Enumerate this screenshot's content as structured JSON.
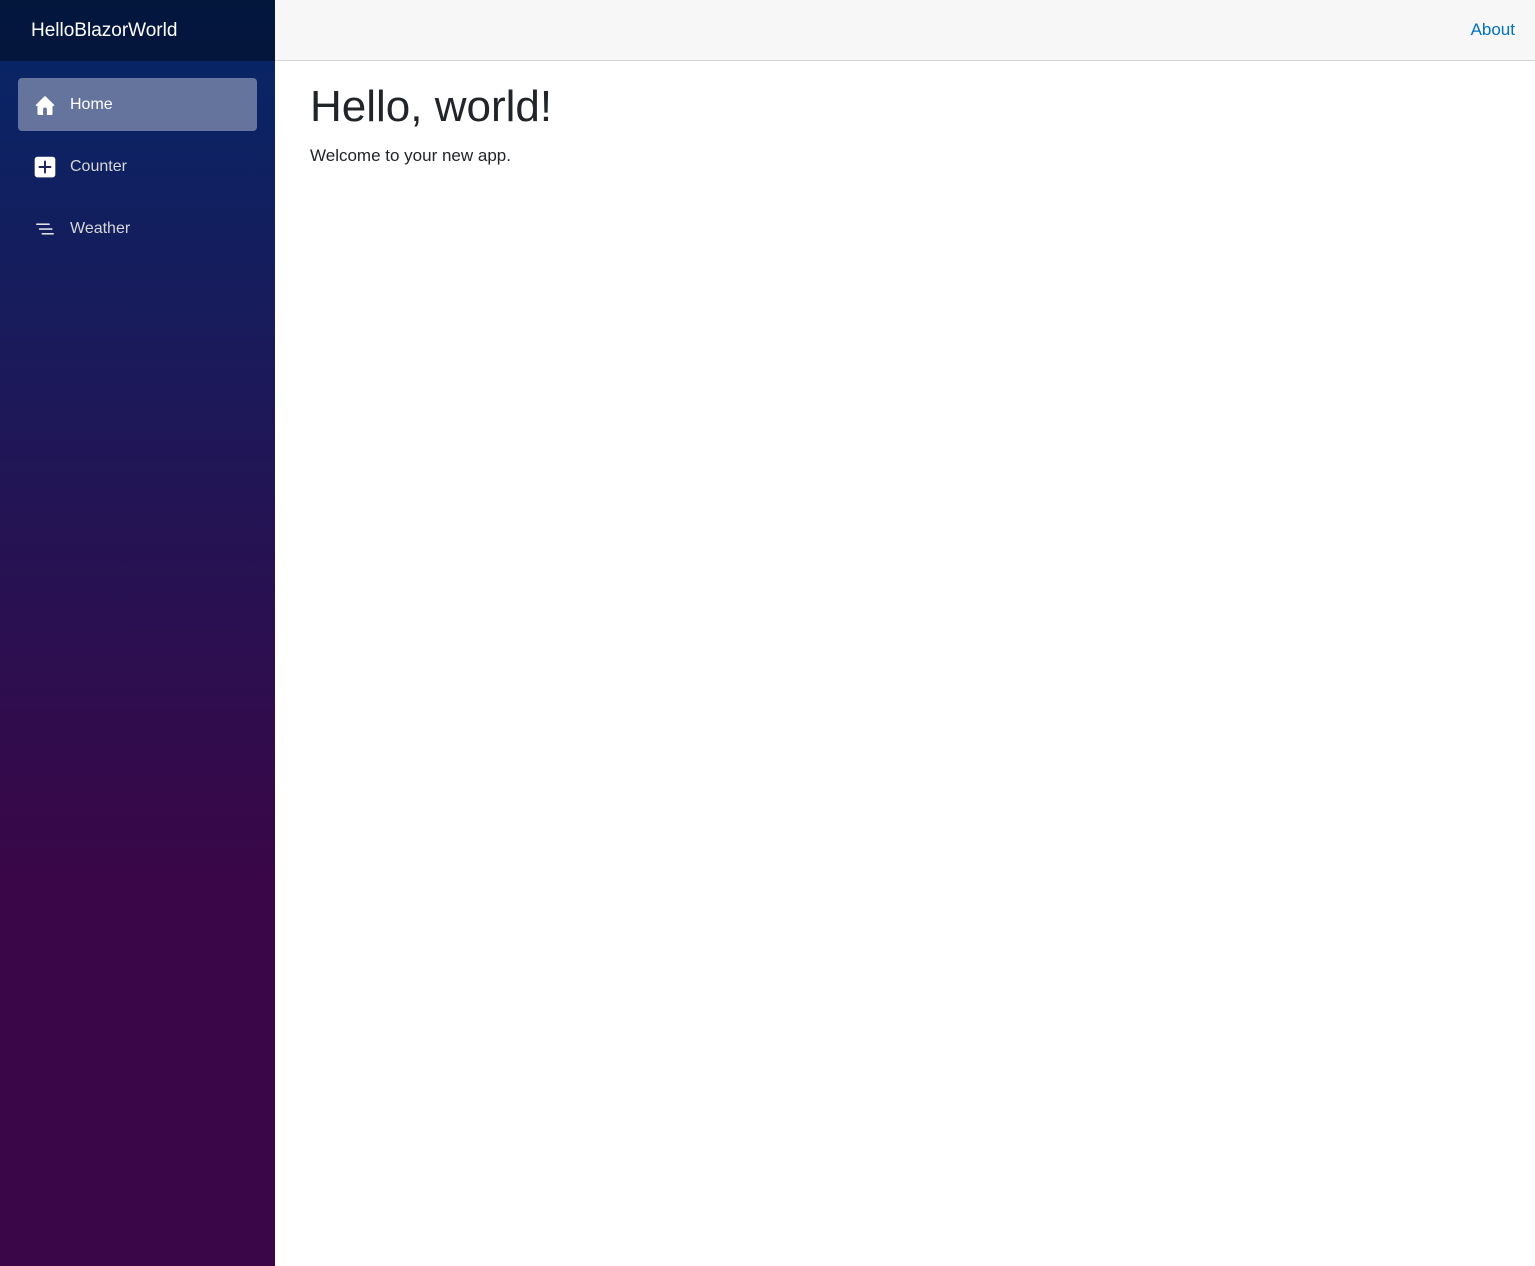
{
  "app": {
    "brand": "HelloBlazorWorld"
  },
  "sidebar": {
    "items": [
      {
        "label": "Home",
        "icon": "home-icon",
        "active": true
      },
      {
        "label": "Counter",
        "icon": "plus-square-icon",
        "active": false
      },
      {
        "label": "Weather",
        "icon": "list-nested-icon",
        "active": false
      }
    ]
  },
  "header": {
    "about_label": "About"
  },
  "main": {
    "title": "Hello, world!",
    "subtitle": "Welcome to your new app."
  },
  "colors": {
    "sidebar_top": "#052767",
    "sidebar_bottom": "#3a0647",
    "link": "#0071c1",
    "top_row_bg": "#f7f7f7"
  }
}
